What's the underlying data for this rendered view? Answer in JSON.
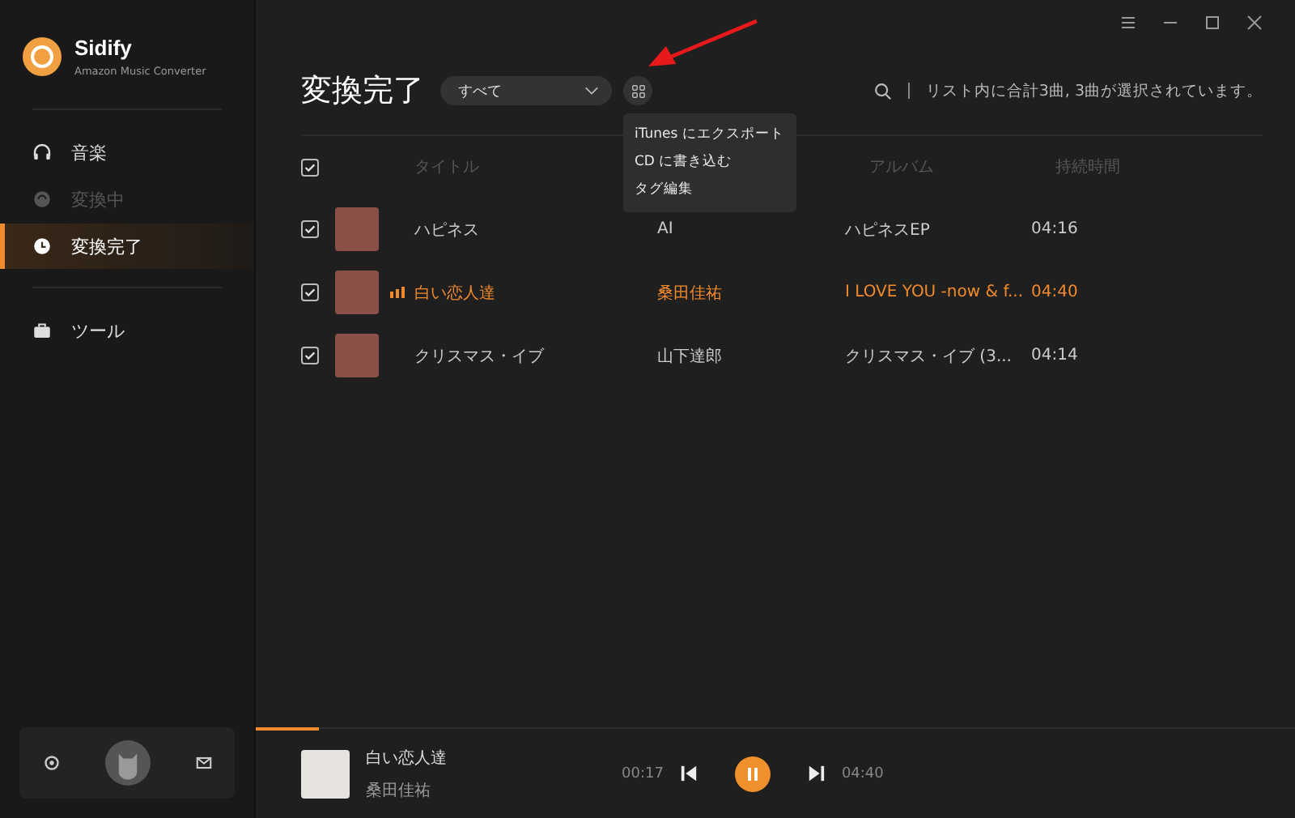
{
  "app": {
    "name": "Sidify",
    "subtitle": "Amazon Music Converter"
  },
  "sidebar": {
    "items": [
      {
        "label": "音楽",
        "kind": "headphones",
        "selected": false,
        "disabled": false
      },
      {
        "label": "変換中",
        "kind": "sync",
        "selected": false,
        "disabled": true
      },
      {
        "label": "変換完了",
        "kind": "clock",
        "selected": true,
        "disabled": false
      },
      {
        "label": "ツール",
        "kind": "toolbox",
        "selected": false,
        "disabled": false
      }
    ]
  },
  "header": {
    "title": "変換完了",
    "filter": "すべて",
    "summary": "リスト内に合計3曲, 3曲が選択されています。"
  },
  "menu": {
    "items": [
      "iTunes にエクスポート",
      "CD に書き込む",
      "タグ編集"
    ]
  },
  "table": {
    "all_checked": true,
    "columns": [
      "タイトル",
      "アルバム",
      "持続時間"
    ],
    "rows": [
      {
        "checked": true,
        "playing": false,
        "title": "ハピネス",
        "artist": "AI",
        "album": "ハピネスEP",
        "duration": "04:16"
      },
      {
        "checked": true,
        "playing": true,
        "title": "白い恋人達",
        "artist": "桑田佳祐",
        "album": "I LOVE YOU -now & f...",
        "duration": "04:40"
      },
      {
        "checked": true,
        "playing": false,
        "title": "クリスマス・イブ",
        "artist": "山下達郎",
        "album": "クリスマス・イブ (3...",
        "duration": "04:14"
      }
    ]
  },
  "player": {
    "title": "白い恋人達",
    "artist": "桑田佳祐",
    "elapsed": "00:17",
    "total": "04:40",
    "level": 0.06,
    "paused": false
  }
}
